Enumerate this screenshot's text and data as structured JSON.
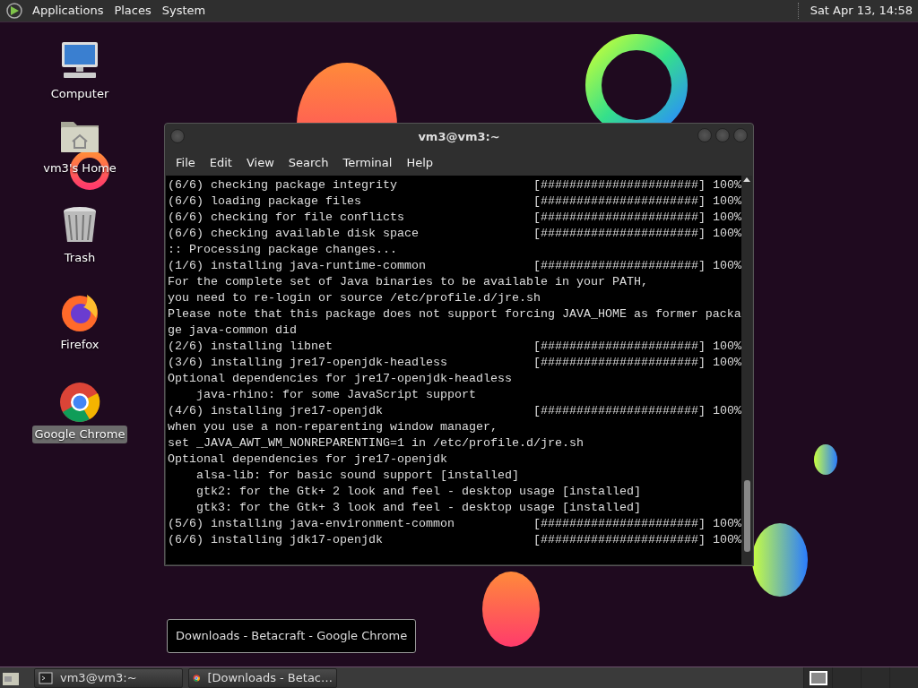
{
  "top_panel": {
    "menus": [
      "Applications",
      "Places",
      "System"
    ],
    "clock": "Sat Apr 13, 14:58"
  },
  "desktop_icons": [
    {
      "kind": "computer",
      "label": "Computer",
      "selected": false
    },
    {
      "kind": "home",
      "label": "vm3's Home",
      "selected": false
    },
    {
      "kind": "trash",
      "label": "Trash",
      "selected": false
    },
    {
      "kind": "firefox",
      "label": "Firefox",
      "selected": false
    },
    {
      "kind": "chrome",
      "label": "Google Chrome",
      "selected": true
    }
  ],
  "terminal": {
    "title": "vm3@vm3:~",
    "menus": [
      "File",
      "Edit",
      "View",
      "Search",
      "Terminal",
      "Help"
    ],
    "lines": [
      {
        "text": "(6/6) checking package integrity",
        "progress": "[######################]",
        "percent": "100%"
      },
      {
        "text": "(6/6) loading package files",
        "progress": "[######################]",
        "percent": "100%"
      },
      {
        "text": "(6/6) checking for file conflicts",
        "progress": "[######################]",
        "percent": "100%"
      },
      {
        "text": "(6/6) checking available disk space",
        "progress": "[######################]",
        "percent": "100%"
      },
      {
        "text": ":: Processing package changes..."
      },
      {
        "text": "(1/6) installing java-runtime-common",
        "progress": "[######################]",
        "percent": "100%"
      },
      {
        "text": "For the complete set of Java binaries to be available in your PATH,"
      },
      {
        "text": "you need to re-login or source /etc/profile.d/jre.sh"
      },
      {
        "text": "Please note that this package does not support forcing JAVA_HOME as former packa"
      },
      {
        "text": "ge java-common did"
      },
      {
        "text": "(2/6) installing libnet",
        "progress": "[######################]",
        "percent": "100%"
      },
      {
        "text": "(3/6) installing jre17-openjdk-headless",
        "progress": "[######################]",
        "percent": "100%"
      },
      {
        "text": "Optional dependencies for jre17-openjdk-headless"
      },
      {
        "text": "    java-rhino: for some JavaScript support"
      },
      {
        "text": "(4/6) installing jre17-openjdk",
        "progress": "[######################]",
        "percent": "100%"
      },
      {
        "text": "when you use a non-reparenting window manager,"
      },
      {
        "text": "set _JAVA_AWT_WM_NONREPARENTING=1 in /etc/profile.d/jre.sh"
      },
      {
        "text": "Optional dependencies for jre17-openjdk"
      },
      {
        "text": "    alsa-lib: for basic sound support [installed]"
      },
      {
        "text": "    gtk2: for the Gtk+ 2 look and feel - desktop usage [installed]"
      },
      {
        "text": "    gtk3: for the Gtk+ 3 look and feel - desktop usage [installed]"
      },
      {
        "text": "(5/6) installing java-environment-common",
        "progress": "[######################]",
        "percent": "100%"
      },
      {
        "text": "(6/6) installing jdk17-openjdk",
        "progress": "[######################]",
        "percent": "100%"
      }
    ]
  },
  "tooltip": "Downloads - Betacraft - Google Chrome",
  "taskbar": {
    "buttons": [
      {
        "kind": "terminal",
        "label": "vm3@vm3:~"
      },
      {
        "kind": "chrome",
        "label": "[Downloads - Betac…"
      }
    ],
    "workspaces": [
      {
        "selected": true
      },
      {
        "selected": false
      },
      {
        "selected": false
      },
      {
        "selected": false
      }
    ]
  }
}
